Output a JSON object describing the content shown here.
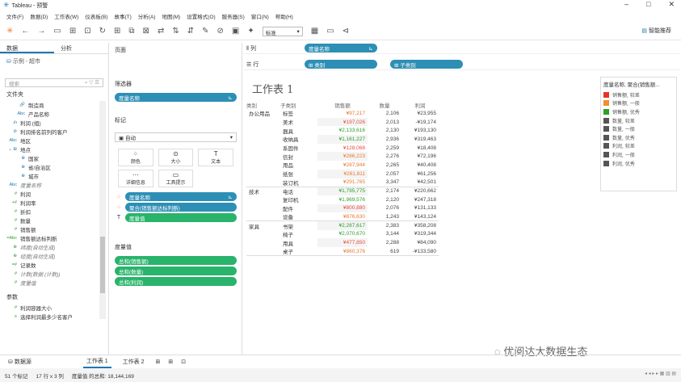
{
  "window": {
    "title": "Tableau - 预警",
    "controls": [
      "–",
      "□",
      "✕"
    ]
  },
  "menu": [
    "文件(F)",
    "数据(D)",
    "工作表(W)",
    "仪表板(B)",
    "故事(T)",
    "分析(A)",
    "地图(M)",
    "设置格式(O)",
    "服务器(S)",
    "窗口(N)",
    "帮助(H)"
  ],
  "toolbar": {
    "view_select": "标准",
    "smart_label": "智能推荐",
    "icons": [
      "tableau-logo-icon",
      "back-icon",
      "forward-icon",
      "save-icon",
      "new-datasource-icon",
      "pause-icon",
      "refresh-icon",
      "new-sheet-icon",
      "duplicate-icon",
      "clear-icon",
      "swap-icon",
      "sort-asc-icon",
      "sort-desc-icon",
      "highlight-icon",
      "group-icon",
      "labels-icon",
      "pin-icon",
      "fit-icon",
      "present-icon",
      "share-icon"
    ]
  },
  "left": {
    "tab_data": "数据",
    "tab_analysis": "分析",
    "datasource": "示例 - 超市",
    "search_placeholder": "搜索",
    "folder_label": "文件夹",
    "fields": [
      {
        "icon": "🔗",
        "label": "制造商",
        "kind": "dim",
        "indent": true
      },
      {
        "icon": "Abc",
        "label": "产品名称",
        "kind": "dim",
        "indent": true
      },
      {
        "icon": ".ılı",
        "label": "利润 (组)",
        "kind": "dim"
      },
      {
        "icon": "⊘",
        "label": "利润排名前列的客户",
        "kind": "dim"
      },
      {
        "icon": "Abc",
        "label": "地区",
        "kind": "dim"
      },
      {
        "icon": "⌄ ⊞",
        "label": "地点",
        "kind": "dim"
      },
      {
        "icon": "⊕",
        "label": "国家",
        "kind": "dim",
        "indent": true
      },
      {
        "icon": "⊕",
        "label": "省/自治区",
        "kind": "dim",
        "indent": true
      },
      {
        "icon": "⊕",
        "label": "城市",
        "kind": "dim",
        "indent": true
      },
      {
        "icon": "Abc",
        "label": "度量名称",
        "kind": "dim",
        "italic": true
      },
      {
        "icon": "#",
        "label": "利润",
        "kind": "mea"
      },
      {
        "icon": "+#",
        "label": "利润率",
        "kind": "mea"
      },
      {
        "icon": "#",
        "label": "折扣",
        "kind": "mea"
      },
      {
        "icon": "#",
        "label": "数量",
        "kind": "mea"
      },
      {
        "icon": "#",
        "label": "销售额",
        "kind": "mea"
      },
      {
        "icon": "=Abc",
        "label": "销售额达标判断",
        "kind": "mea"
      },
      {
        "icon": "⊕",
        "label": "纬度(自动生成)",
        "kind": "mea",
        "italic": true
      },
      {
        "icon": "⊕",
        "label": "经度(自动生成)",
        "kind": "mea",
        "italic": true
      },
      {
        "icon": "=#",
        "label": "记录数",
        "kind": "mea"
      },
      {
        "icon": "#",
        "label": "计数(数据 (计数))",
        "kind": "mea",
        "italic": true
      },
      {
        "icon": "#",
        "label": "度量值",
        "kind": "mea",
        "italic": true
      }
    ],
    "params_label": "参数",
    "params": [
      {
        "icon": "#",
        "label": "利润容器大小"
      },
      {
        "icon": "≡",
        "label": "选择利润最多少名客户"
      }
    ]
  },
  "cards": {
    "pages": "页面",
    "filters": "筛选器",
    "filter_pill": "度量名称",
    "marks": "标记",
    "marks_type": "自动",
    "mark_buttons": [
      {
        "glyph": "⁘",
        "label": "颜色"
      },
      {
        "glyph": "⊙",
        "label": "大小"
      },
      {
        "glyph": "T",
        "label": "文本"
      },
      {
        "glyph": "⋯",
        "label": "详细信息"
      },
      {
        "glyph": "▭",
        "label": "工具提示"
      }
    ],
    "mark_pills": [
      {
        "icon": "⁘",
        "label": "度量名称",
        "kind": "dim",
        "extra": "⊾"
      },
      {
        "icon": "⁘",
        "label": "聚合(销售额达标判断)",
        "kind": "dim",
        "extra": ""
      },
      {
        "icon": "T",
        "label": "度量值",
        "kind": "mea",
        "extra": ""
      }
    ],
    "measure_values": "度量值",
    "mv_pills": [
      "总和(销售额)",
      "总和(数量)",
      "总和(利润)"
    ]
  },
  "shelves": {
    "cols_label": "列",
    "rows_label": "行",
    "col_pill": "度量名称",
    "row_pills": [
      "类别",
      "子类别"
    ]
  },
  "sheet": {
    "title": "工作表 1"
  },
  "table": {
    "headers": [
      "类别",
      "子类别",
      "销售额",
      "数量",
      "利润"
    ],
    "rows": [
      {
        "cat": "办公用品",
        "sub": "标签",
        "sales": "¥97,217",
        "sc": "#e8772e",
        "qty": "2,106",
        "profit": "¥23,955"
      },
      {
        "cat": "",
        "sub": "美术",
        "sales": "¥197,026",
        "sc": "#e84c3d",
        "qty": "2,013",
        "profit": "-¥19,174"
      },
      {
        "cat": "",
        "sub": "器具",
        "sales": "¥2,133,616",
        "sc": "#2ca02c",
        "qty": "2,130",
        "profit": "¥193,130"
      },
      {
        "cat": "",
        "sub": "收纳具",
        "sales": "¥1,161,227",
        "sc": "#2ca02c",
        "qty": "2,936",
        "profit": "¥319,463"
      },
      {
        "cat": "",
        "sub": "系固件",
        "sales": "¥128,068",
        "sc": "#e84c3d",
        "qty": "2,259",
        "profit": "¥18,408"
      },
      {
        "cat": "",
        "sub": "信封",
        "sales": "¥286,223",
        "sc": "#e8772e",
        "qty": "2,276",
        "profit": "¥72,196"
      },
      {
        "cat": "",
        "sub": "用品",
        "sales": "¥287,944",
        "sc": "#e8772e",
        "qty": "2,265",
        "profit": "¥40,408"
      },
      {
        "cat": "",
        "sub": "纸张",
        "sales": "¥261,811",
        "sc": "#e8772e",
        "qty": "2,057",
        "profit": "¥61,256"
      },
      {
        "cat": "",
        "sub": "装订机",
        "sales": "¥291,765",
        "sc": "#e8772e",
        "qty": "3,347",
        "profit": "¥42,501",
        "end": true
      },
      {
        "cat": "技术",
        "sub": "电话",
        "sales": "¥1,795,775",
        "sc": "#2ca02c",
        "qty": "2,174",
        "profit": "¥220,662"
      },
      {
        "cat": "",
        "sub": "复印机",
        "sales": "¥1,969,576",
        "sc": "#2ca02c",
        "qty": "2,120",
        "profit": "¥247,318"
      },
      {
        "cat": "",
        "sub": "配件",
        "sales": "¥800,880",
        "sc": "#e84c3d",
        "qty": "2,076",
        "profit": "¥131,133"
      },
      {
        "cat": "",
        "sub": "设备",
        "sales": "¥876,630",
        "sc": "#e8772e",
        "qty": "1,243",
        "profit": "¥143,124",
        "end": true
      },
      {
        "cat": "家具",
        "sub": "书架",
        "sales": "¥2,287,617",
        "sc": "#2ca02c",
        "qty": "2,383",
        "profit": "¥358,208"
      },
      {
        "cat": "",
        "sub": "椅子",
        "sales": "¥2,070,670",
        "sc": "#2ca02c",
        "qty": "3,144",
        "profit": "¥319,344"
      },
      {
        "cat": "",
        "sub": "用具",
        "sales": "¥477,850",
        "sc": "#e84c3d",
        "qty": "2,288",
        "profit": "¥84,090"
      },
      {
        "cat": "",
        "sub": "桌子",
        "sales": "¥860,376",
        "sc": "#e8772e",
        "qty": "619",
        "profit": "-¥133,580",
        "end": true
      }
    ]
  },
  "legend": {
    "title": "度量名称, 聚合(销售额...",
    "items": [
      {
        "color": "#e8332a",
        "label": "销售额, 较差"
      },
      {
        "color": "#f28e2b",
        "label": "销售额, 一般"
      },
      {
        "color": "#2ca02c",
        "label": "销售额, 优秀"
      },
      {
        "color": "#555555",
        "label": "数量, 较差"
      },
      {
        "color": "#555555",
        "label": "数量, 一般"
      },
      {
        "color": "#555555",
        "label": "数量, 优秀"
      },
      {
        "color": "#555555",
        "label": "利润, 较差"
      },
      {
        "color": "#555555",
        "label": "利润, 一般"
      },
      {
        "color": "#555555",
        "label": "利润, 优秀"
      }
    ]
  },
  "bottom": {
    "datasource_tab": "数据源",
    "sheet1": "工作表 1",
    "sheet2": "工作表 2"
  },
  "status": {
    "marks": "51 个标记",
    "rows_cols": "17 行 x 3 列",
    "sum": "度量值 的总和: 18,144,169"
  },
  "watermark": "优阅达大数据生态"
}
